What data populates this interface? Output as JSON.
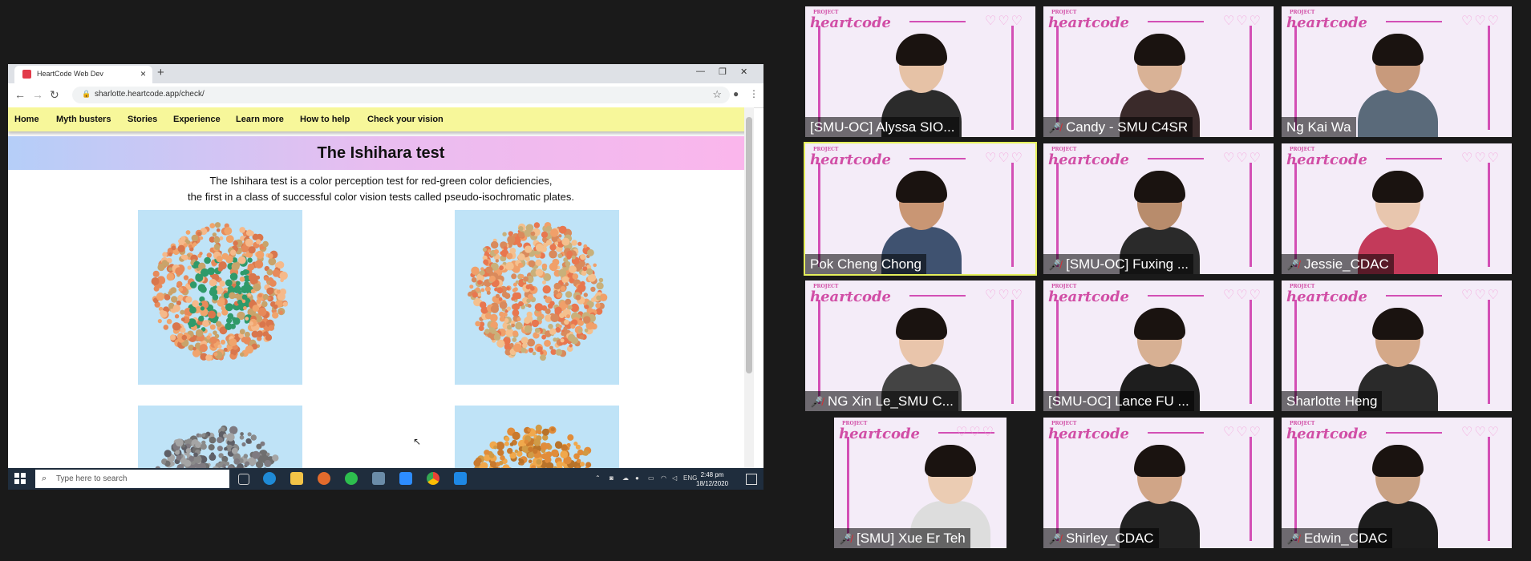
{
  "browser": {
    "tab_title": "HeartCode Web Dev",
    "new_tab": "+",
    "tab_close": "×",
    "url": "sharlotte.heartcode.app/check/"
  },
  "site": {
    "nav": [
      "Home",
      "Myth busters",
      "Stories",
      "Experience",
      "Learn more",
      "How to help",
      "Check your vision"
    ],
    "title": "The Ishihara test",
    "desc_line1": "The Ishihara test is a color perception test for red-green color deficiencies,",
    "desc_line2": "the first in a class of successful color vision tests called pseudo-isochromatic plates."
  },
  "taskbar": {
    "search_placeholder": "Type here to search",
    "lang": "ENG",
    "time": "2:48 pm",
    "date": "18/12/2020"
  },
  "participants": [
    {
      "name": "[SMU-OC] Alyssa SIO...",
      "muted": false,
      "skin": "#e6c2a6",
      "shirt": "#2b2b2b"
    },
    {
      "name": "Candy - SMU C4SR",
      "muted": true,
      "skin": "#d9b296",
      "shirt": "#3a2a2a"
    },
    {
      "name": "Ng Kai Wa",
      "muted": false,
      "skin": "#c89a7c",
      "shirt": "#5a6a7a"
    },
    {
      "name": "Pok Cheng Chong",
      "muted": false,
      "active": true,
      "skin": "#c99674",
      "shirt": "#3f5270"
    },
    {
      "name": "[SMU-OC] Fuxing ...",
      "muted": true,
      "skin": "#b88c6c",
      "shirt": "#2a2a2a"
    },
    {
      "name": "Jessie_CDAC",
      "muted": true,
      "skin": "#e8c6ae",
      "shirt": "#c33a5a"
    },
    {
      "name": "NG Xin Le_SMU C...",
      "muted": true,
      "skin": "#e9c5ab",
      "shirt": "#444"
    },
    {
      "name": "[SMU-OC] Lance  FU ...",
      "muted": false,
      "skin": "#d7b093",
      "shirt": "#1e1e1e"
    },
    {
      "name": "Sharlotte Heng",
      "muted": false,
      "skin": "#d4a888",
      "shirt": "#2a2a2a"
    },
    {
      "name": "[SMU] Xue Er Teh",
      "muted": true,
      "skin": "#ebccb3",
      "shirt": "#dddddd"
    },
    {
      "name": "Shirley_CDAC",
      "muted": true,
      "skin": "#d0a587",
      "shirt": "#222"
    },
    {
      "name": "Edwin_CDAC",
      "muted": true,
      "skin": "#c9a183",
      "shirt": "#1d1d1d"
    }
  ],
  "branding": {
    "logo_small": "PROJECT",
    "logo": "heartcode",
    "hearts": "♡♡♡"
  }
}
